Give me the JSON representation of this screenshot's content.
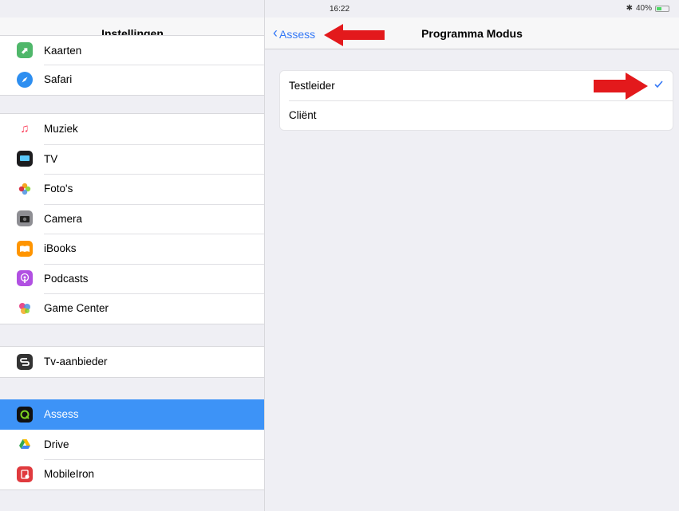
{
  "status_bar": {
    "device": "iPad",
    "time": "16:22",
    "battery": "40%"
  },
  "sidebar": {
    "title": "Instellingen",
    "partial_item": "Kaarten",
    "group1": [
      {
        "label": "Safari",
        "icon": "safari-icon",
        "color": "#2d8ef0"
      }
    ],
    "group2": [
      {
        "label": "Muziek",
        "icon": "music-icon",
        "color": "#fb3c58"
      },
      {
        "label": "TV",
        "icon": "tv-icon",
        "color": "#1c1c1e"
      },
      {
        "label": "Foto's",
        "icon": "photos-icon",
        "color": "#f39c12"
      },
      {
        "label": "Camera",
        "icon": "camera-icon",
        "color": "#555555"
      },
      {
        "label": "iBooks",
        "icon": "ibooks-icon",
        "color": "#ff9500"
      },
      {
        "label": "Podcasts",
        "icon": "podcasts-icon",
        "color": "#b150e2"
      },
      {
        "label": "Game Center",
        "icon": "game-center-icon",
        "color": "#e84c8b"
      }
    ],
    "group3": [
      {
        "label": "Tv-aanbieder",
        "icon": "tv-provider-icon",
        "color": "#333333"
      }
    ],
    "group4": [
      {
        "label": "Assess",
        "icon": "assess-icon",
        "color": "#111111"
      },
      {
        "label": "Drive",
        "icon": "drive-icon",
        "color": "#ffffff"
      },
      {
        "label": "MobileIron",
        "icon": "mobileiron-icon",
        "color": "#e03a3e"
      }
    ]
  },
  "detail": {
    "back_label": "Assess",
    "title": "Programma Modus",
    "options": [
      "Testleider",
      "Cliënt"
    ],
    "selected_option": "Testleider"
  },
  "colors": {
    "accent": "#3478f6",
    "selection": "#3d93f7",
    "annotation_arrow": "#e3191c"
  }
}
